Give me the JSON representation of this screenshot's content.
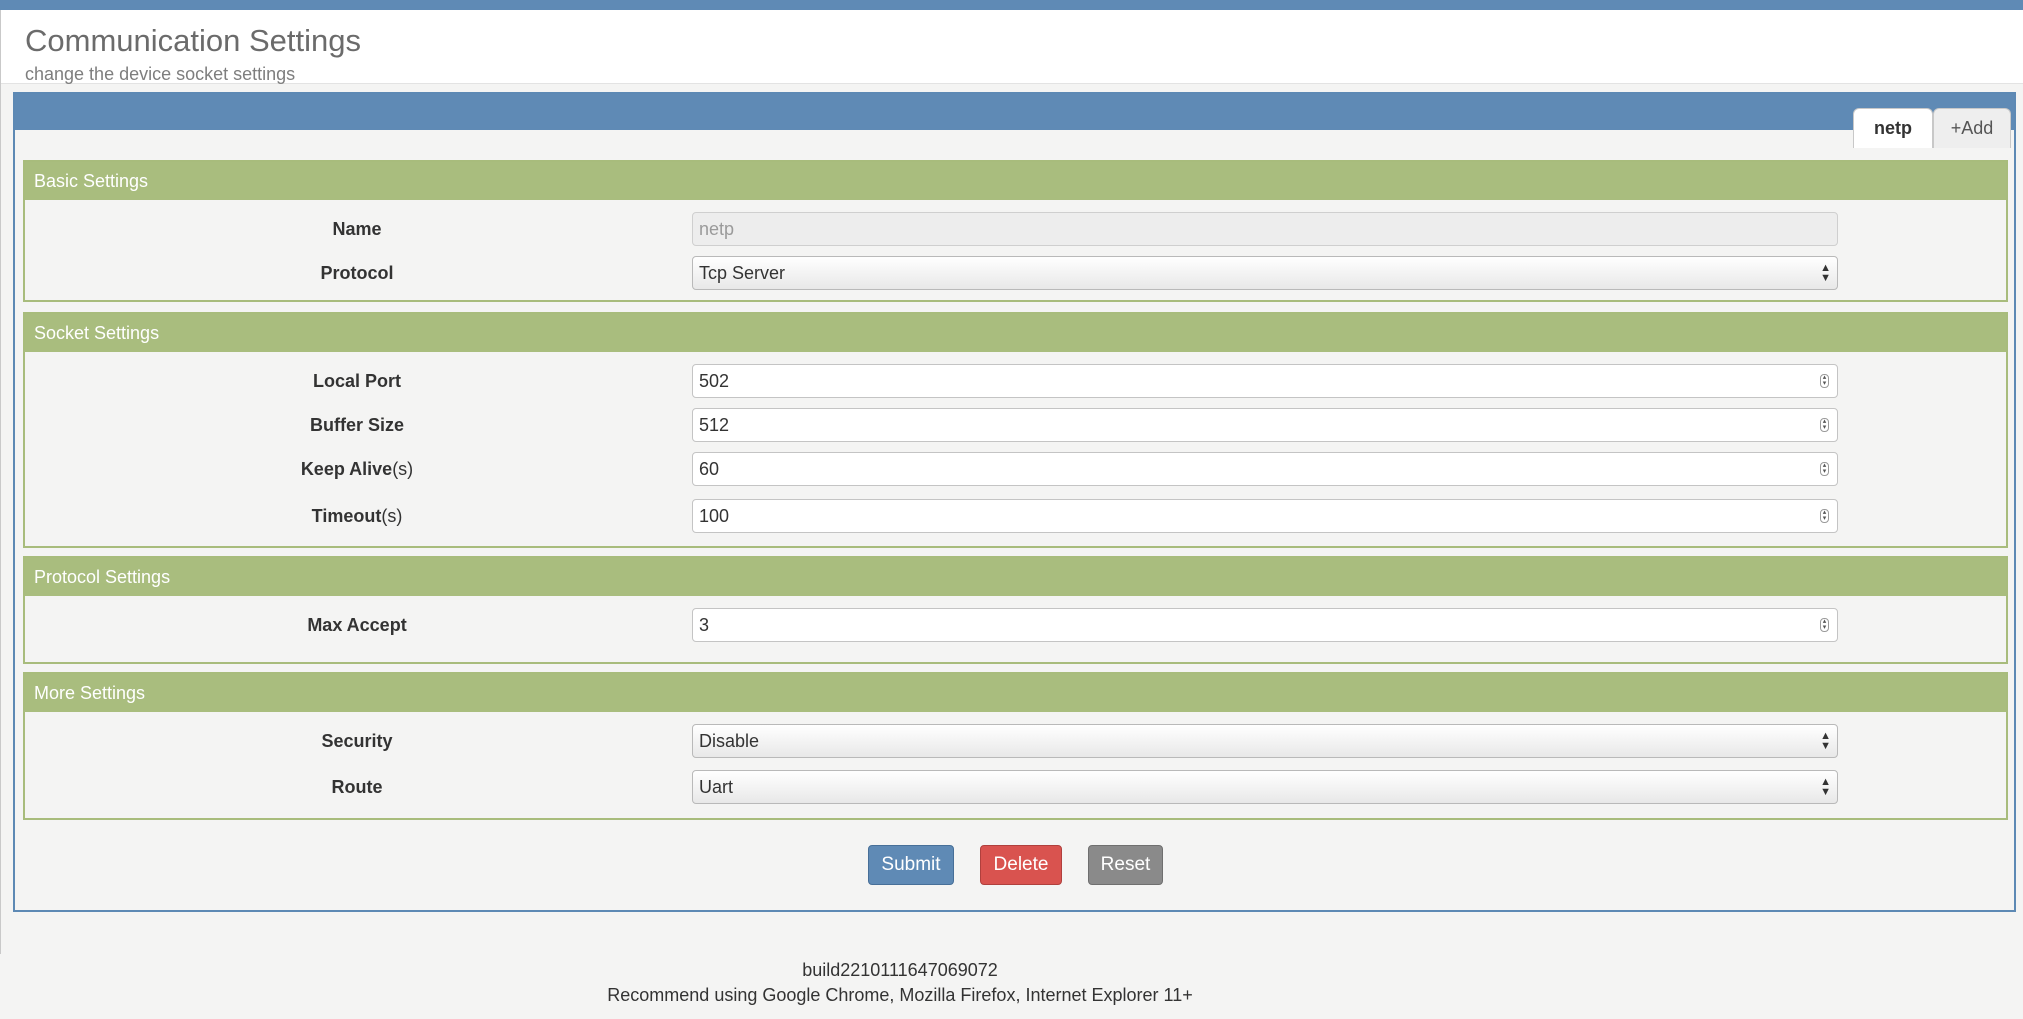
{
  "header": {
    "title": "Communication Settings",
    "subtitle": "change the device socket settings"
  },
  "tabs": {
    "active": "netp",
    "add": "+Add"
  },
  "sections": {
    "basic": {
      "title": "Basic Settings",
      "name_label": "Name",
      "name_value": "netp",
      "protocol_label": "Protocol",
      "protocol_value": "Tcp Server"
    },
    "socket": {
      "title": "Socket Settings",
      "local_port_label": "Local Port",
      "local_port_value": "502",
      "buffer_size_label": "Buffer Size",
      "buffer_size_value": "512",
      "keep_alive_label": "Keep Alive",
      "keep_alive_unit": "(s)",
      "keep_alive_value": "60",
      "timeout_label": "Timeout",
      "timeout_unit": "(s)",
      "timeout_value": "100"
    },
    "protocol": {
      "title": "Protocol Settings",
      "max_accept_label": "Max Accept",
      "max_accept_value": "3"
    },
    "more": {
      "title": "More Settings",
      "security_label": "Security",
      "security_value": "Disable",
      "route_label": "Route",
      "route_value": "Uart"
    }
  },
  "actions": {
    "submit": "Submit",
    "delete": "Delete",
    "reset": "Reset"
  },
  "footer": {
    "build": "build2210111647069072",
    "recommend": "Recommend using Google Chrome, Mozilla Firefox, Internet Explorer 11+"
  },
  "icons": {
    "spinner": "number-spinner-icon",
    "select": "select-updown-icon"
  },
  "colors": {
    "primary": "#5f8ab5",
    "section_header": "#a9bd7e",
    "danger": "#d9534f",
    "neutral": "#8a8a8a"
  }
}
